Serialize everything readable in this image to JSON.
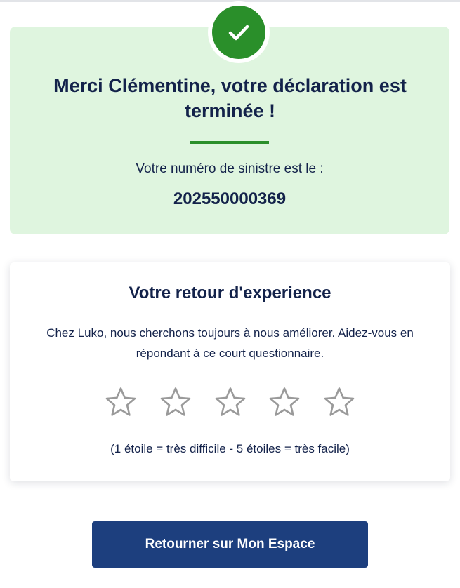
{
  "confirmation": {
    "icon": "check-icon",
    "title": "Merci Clémentine, votre déclaration est terminée !",
    "claim_label": "Votre numéro de sinistre est le :",
    "claim_number": "202550000369"
  },
  "feedback": {
    "title": "Votre retour d'experience",
    "description": "Chez Luko, nous cherchons toujours à nous améliorer. Aidez-vous en répondant à ce court questionnaire.",
    "rating": {
      "max": 5,
      "selected": 0,
      "star_icon": "star-outline-icon"
    },
    "scale_hint": "(1 étoile = très difficile - 5 étoiles = très facile)"
  },
  "actions": {
    "return_label": "Retourner sur Mon Espace"
  },
  "colors": {
    "success_background": "#dff5df",
    "success_accent": "#2a8f2a",
    "text_primary": "#13224a",
    "button_primary": "#1d3f7e",
    "star_outline": "#9a9a9a"
  }
}
